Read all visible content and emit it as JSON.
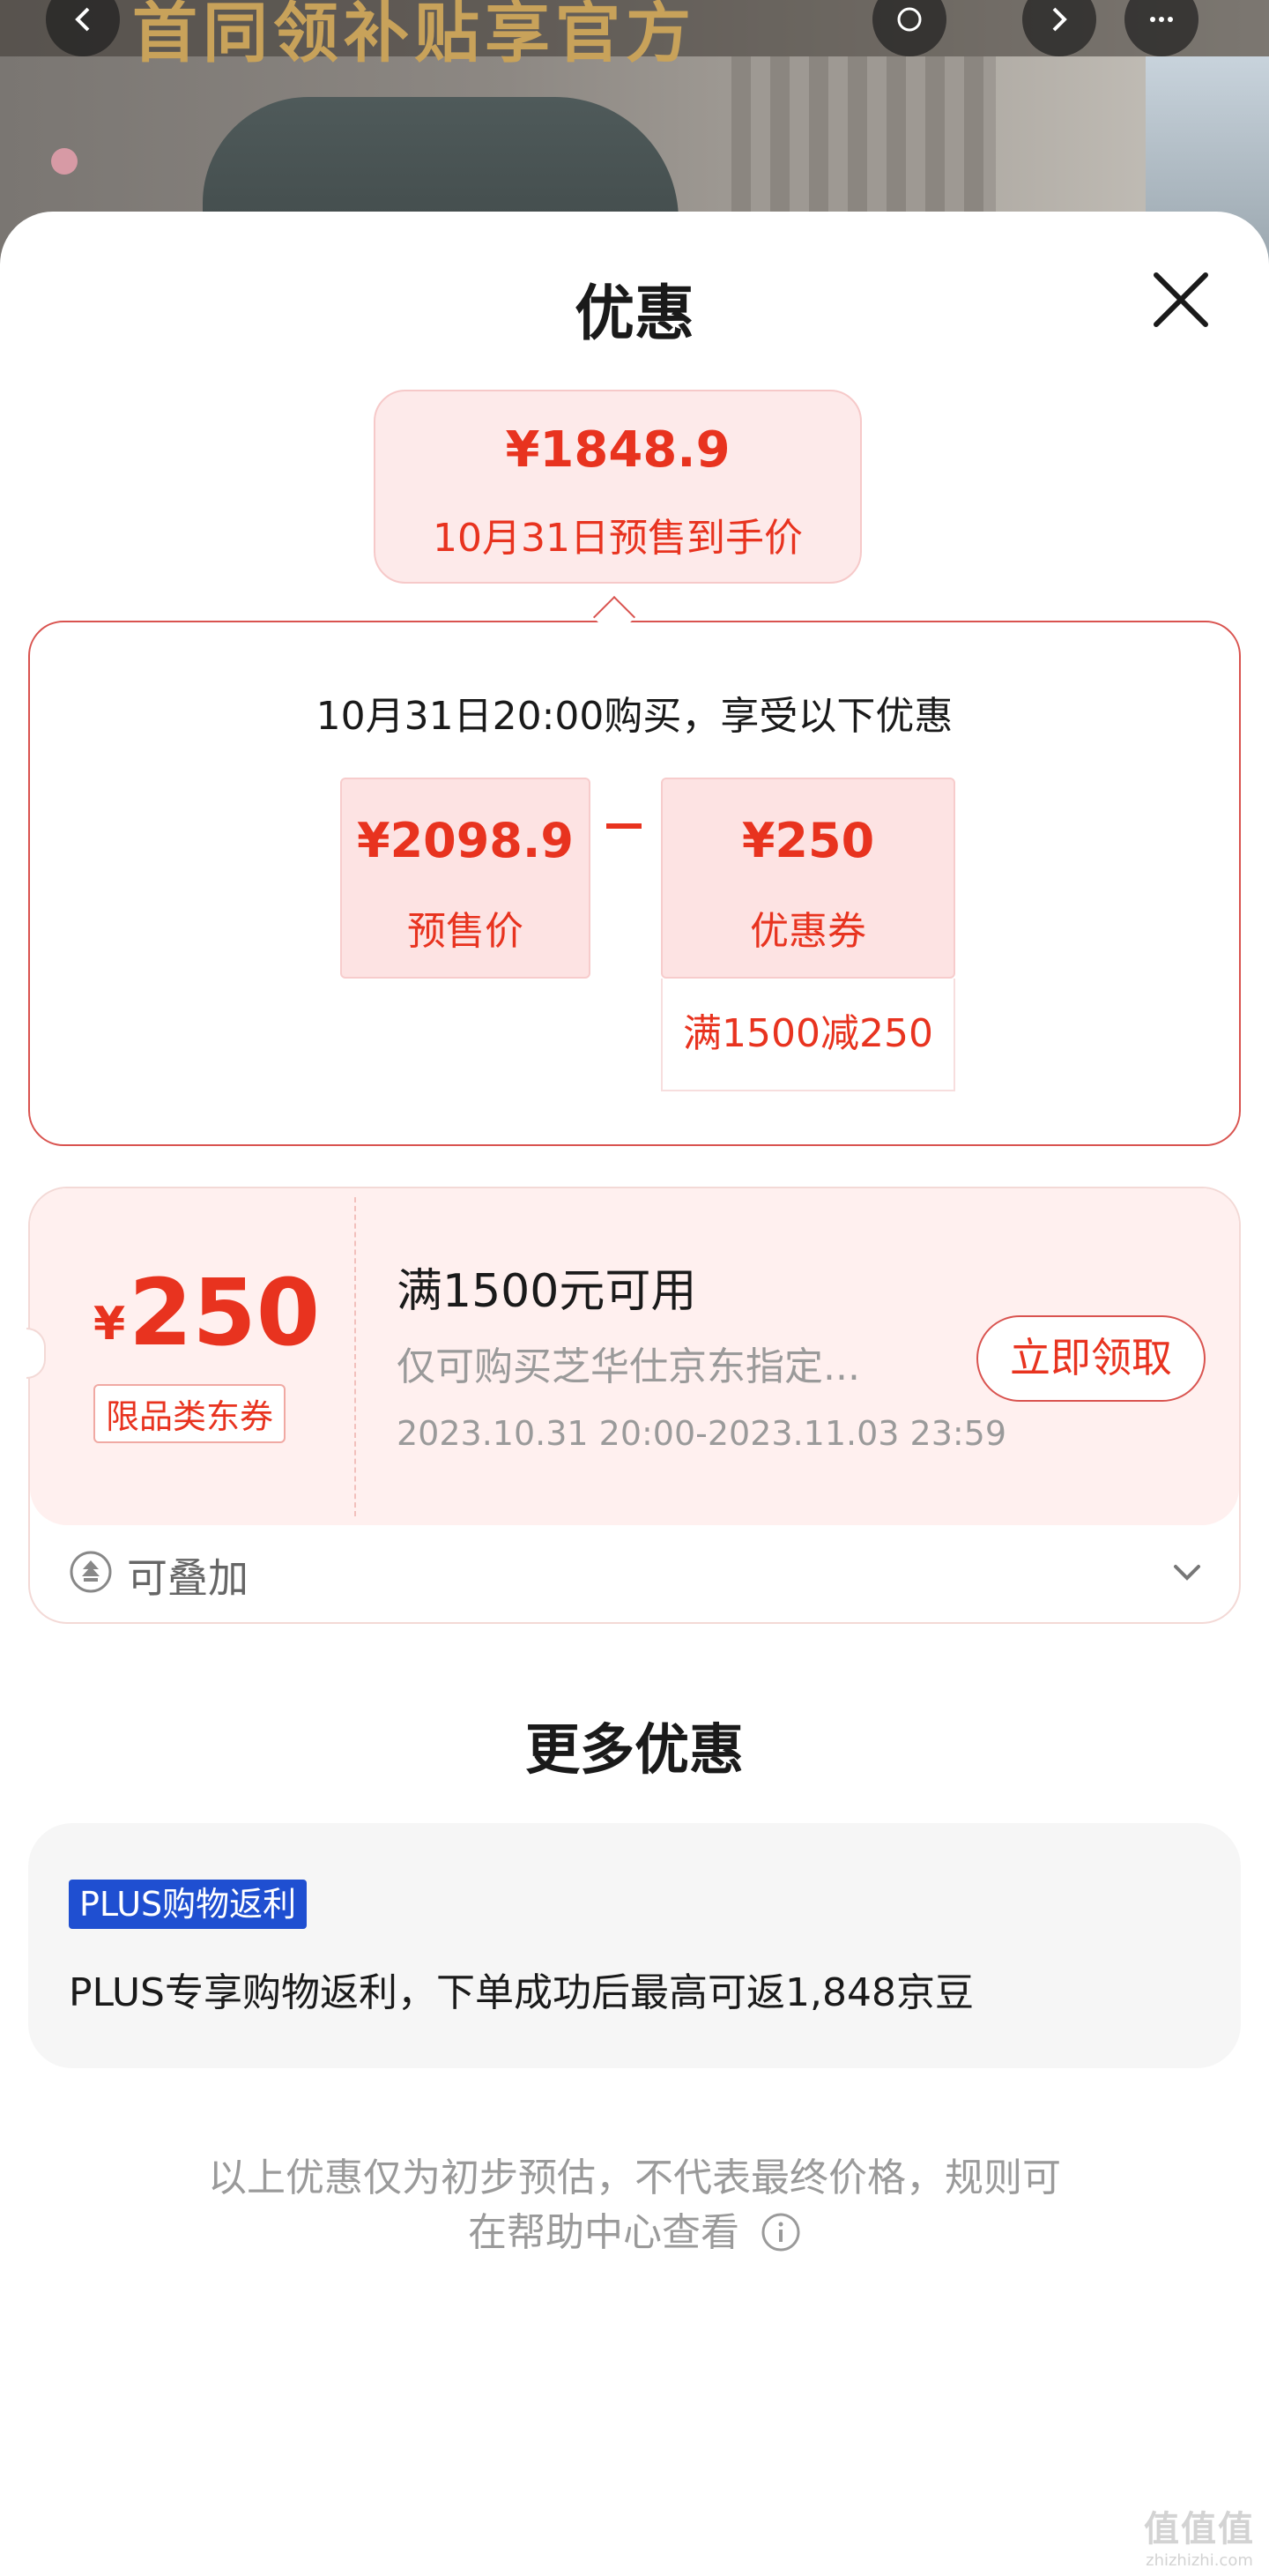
{
  "backdrop": {
    "banner_text": "首同领补贴享官方",
    "back_icon": "chevron-left-icon",
    "share_icon": "share-icon",
    "more_icon": "more-icon"
  },
  "sheet": {
    "title": "优惠",
    "close_icon": "close-icon"
  },
  "final_price": {
    "value": "¥1848.9",
    "label": "10月31日预售到手价"
  },
  "calculation": {
    "heading": "10月31日20:00购买，享受以下优惠",
    "presale_price": {
      "value": "¥2098.9",
      "label": "预售价"
    },
    "operator": "-",
    "coupon": {
      "value": "¥250",
      "label": "优惠券",
      "detail": "满1500减250"
    }
  },
  "coupon_card": {
    "currency": "¥",
    "amount": "250",
    "type": "限品类东券",
    "condition": "满1500元可用",
    "scope": "仅可购买芝华仕京东指定...",
    "validity": "2023.10.31 20:00-2023.11.03 23:59",
    "claim_button": "立即领取",
    "stackable_label": "可叠加"
  },
  "more_offers": {
    "title": "更多优惠",
    "plus_badge": "PLUS购物返利",
    "plus_description": "PLUS专享购物返利，下单成功后最高可返1,848京豆"
  },
  "disclaimer": {
    "line1": "以上优惠仅为初步预估，不代表最终价格，规则可",
    "line2": "在帮助中心查看"
  },
  "watermark": {
    "logo": "值值值",
    "url": "zhizhizhi.com"
  },
  "colors": {
    "price_red": "#e8331f",
    "border_red": "#d9534f",
    "plus_blue": "#1f4fd1"
  }
}
